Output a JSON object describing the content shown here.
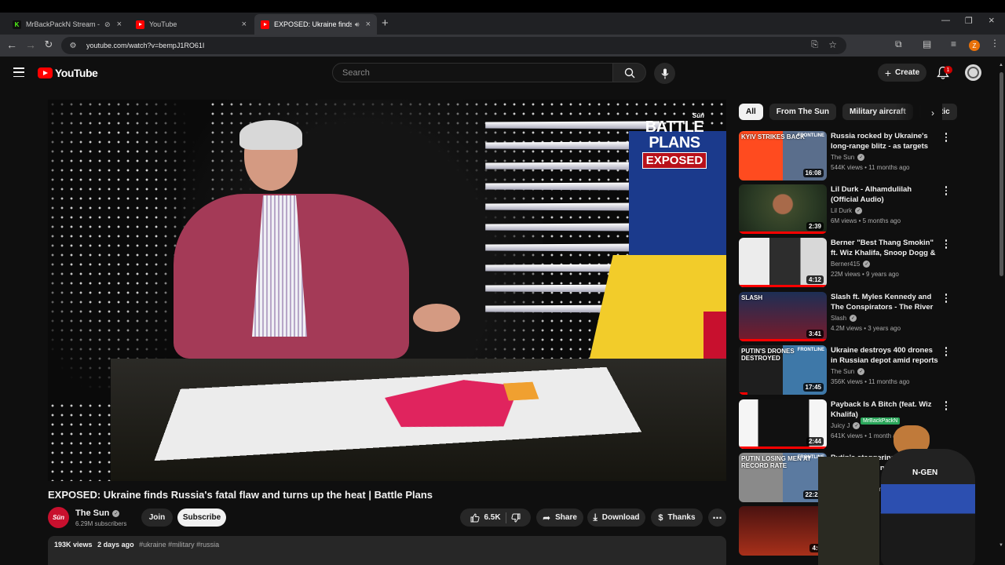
{
  "browser": {
    "tabs": [
      {
        "label": "MrBackPackN Stream - Wat",
        "favicon": "K",
        "muted": true,
        "active": false
      },
      {
        "label": "YouTube",
        "favicon": "yt",
        "muted": false,
        "active": false
      },
      {
        "label": "EXPOSED: Ukraine finds Ru",
        "favicon": "yt",
        "muted": false,
        "audio": true,
        "active": true
      }
    ],
    "new_tab_symbol": "+",
    "url": "youtube.com/watch?v=bempJ1RO61I",
    "profile_initial": "Z"
  },
  "youtube": {
    "logo_text": "YouTube",
    "search_placeholder": "Search",
    "create_label": "Create",
    "notification_count": "1"
  },
  "player": {
    "overlay_sun": "Sün",
    "overlay_line1": "BATTLE",
    "overlay_line2": "PLANS",
    "overlay_line3": "EXPOSED"
  },
  "video": {
    "title": "EXPOSED: Ukraine finds Russia's fatal flaw and turns up the heat | Battle Plans",
    "channel": "The Sun",
    "channel_avatar_text": "Sün",
    "subscribers": "6.29M subscribers",
    "join_label": "Join",
    "subscribe_label": "Subscribe",
    "likes": "6.5K",
    "share_label": "Share",
    "download_label": "Download",
    "thanks_label": "Thanks",
    "views": "193K views",
    "posted": "2 days ago",
    "hashtags": "#ukraine #military #russia"
  },
  "chips": [
    "All",
    "From The Sun",
    "Military aircraft",
    "Politic"
  ],
  "recommendations": [
    {
      "title": "Russia rocked by Ukraine's long-range blitz - as targets reveale...",
      "channel": "The Sun",
      "verified": true,
      "meta": "544K views • 11 months ago",
      "duration": "16:08",
      "caption": "KYIV STRIKES BACK",
      "caption_right": "FRONTLINE",
      "progress": 0
    },
    {
      "title": "Lil Durk - Alhamdulilah (Official Audio)",
      "channel": "Lil Durk",
      "verified": true,
      "meta": "6M views • 5 months ago",
      "duration": "2:39",
      "caption": "",
      "caption_right": "",
      "progress": 1.0
    },
    {
      "title": "Berner \"Best Thang Smokin\" ft. Wiz Khalifa, Snoop Dogg & B-...",
      "channel": "Berner415",
      "verified": true,
      "meta": "22M views • 9 years ago",
      "duration": "4:12",
      "caption": "",
      "caption_right": "",
      "progress": 1.0
    },
    {
      "title": "Slash ft. Myles Kennedy and The Conspirators - The River I...",
      "channel": "Slash",
      "verified": true,
      "meta": "4.2M views • 3 years ago",
      "duration": "3:41",
      "caption": "SLASH",
      "caption_right": "",
      "progress": 1.0
    },
    {
      "title": "Ukraine destroys 400 drones in Russian depot amid reports ...",
      "channel": "The Sun",
      "verified": true,
      "meta": "356K views • 11 months ago",
      "duration": "17:45",
      "caption": "PUTIN'S DRONES DESTROYED",
      "caption_right": "FRONTLINE",
      "progress": 0.1
    },
    {
      "title": "Payback Is A Bitch (feat. Wiz Khalifa)",
      "channel": "Juicy J",
      "verified": true,
      "meta": "641K views • 1 month a",
      "duration": "2:44",
      "caption": "",
      "caption_right": "",
      "progress": 1.0
    },
    {
      "title": "Putin's staggering w... ussian casualties hit n",
      "channel": "The Sun",
      "verified": true,
      "meta": "93K views • 9 months a",
      "duration": "22:22",
      "caption": "PUTIN LOSING MEN AT RECORD RATE",
      "caption_right": "FRONTLINE",
      "progress": 0
    },
    {
      "title": "Juice WRLD - Audio)",
      "channel": "Juic",
      "verified": false,
      "meta": "",
      "duration": "4:0",
      "caption": "",
      "caption_right": "",
      "progress": 0
    }
  ],
  "stream_overlay": {
    "tag": "MrBackPackN",
    "chair_brand": "N-GEN"
  },
  "colors": {
    "background": "#0f0f0f",
    "yt_red": "#ff0000",
    "chip_active_bg": "#f1f1f1",
    "secondary_text": "#aaaaaa"
  }
}
